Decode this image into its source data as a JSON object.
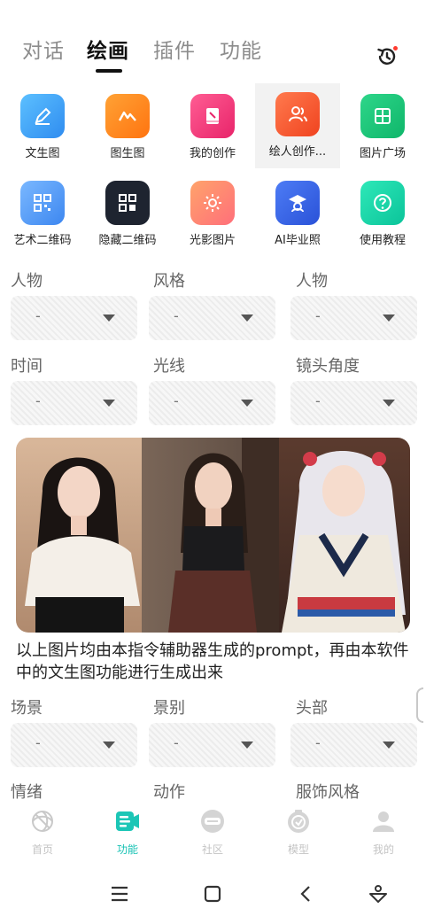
{
  "tabs": [
    {
      "label": "对话"
    },
    {
      "label": "绘画"
    },
    {
      "label": "插件"
    },
    {
      "label": "功能"
    }
  ],
  "grid": [
    {
      "label": "文生图",
      "icon": "pen-icon",
      "color": "#3aa0f5"
    },
    {
      "label": "图生图",
      "icon": "mountain-icon",
      "color": "#ff8a1e"
    },
    {
      "label": "我的创作",
      "icon": "book-icon",
      "color": "#f23b7d"
    },
    {
      "label": "绘人创作...",
      "icon": "people-icon",
      "color": "#ff5b36"
    },
    {
      "label": "图片广场",
      "icon": "image-icon",
      "color": "#12c277"
    },
    {
      "label": "艺术二维码",
      "icon": "qrcode-icon",
      "color": "#4a9cf7"
    },
    {
      "label": "隐藏二维码",
      "icon": "qrcode-dark-icon",
      "color": "#1e2430"
    },
    {
      "label": "光影图片",
      "icon": "sun-icon",
      "color": "#ff8f5a"
    },
    {
      "label": "AI毕业照",
      "icon": "graduate-icon",
      "color": "#3364e8"
    },
    {
      "label": "使用教程",
      "icon": "help-icon",
      "color": "#10d6a8"
    }
  ],
  "selectors_top": [
    {
      "label": "人物",
      "value": "-"
    },
    {
      "label": "风格",
      "value": "-"
    },
    {
      "label": "人物",
      "value": "-"
    },
    {
      "label": "时间",
      "value": "-"
    },
    {
      "label": "光线",
      "value": "-"
    },
    {
      "label": "镜头角度",
      "value": "-"
    }
  ],
  "caption": "以上图片均由本指令辅助器生成的prompt，再由本软件中的文生图功能进行生成出来",
  "selectors_bottom": [
    {
      "label": "场景",
      "value": "-"
    },
    {
      "label": "景别",
      "value": "-"
    },
    {
      "label": "头部",
      "value": "-"
    },
    {
      "label": "情绪"
    },
    {
      "label": "动作"
    },
    {
      "label": "服饰风格"
    }
  ],
  "bottom_nav": [
    {
      "label": "首页",
      "icon": "home-swirl-icon"
    },
    {
      "label": "功能",
      "icon": "function-icon"
    },
    {
      "label": "社区",
      "icon": "community-icon"
    },
    {
      "label": "模型",
      "icon": "model-icon"
    },
    {
      "label": "我的",
      "icon": "profile-icon"
    }
  ],
  "colors": {
    "accent": "#17c2b4",
    "tab_active": "#111111",
    "tab_inactive": "#8c8c8c"
  }
}
